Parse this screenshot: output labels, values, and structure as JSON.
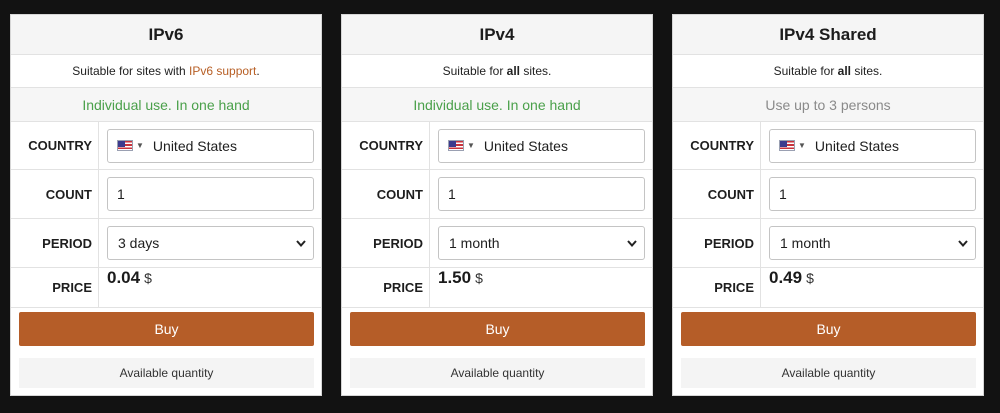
{
  "colors": {
    "background": "#121212",
    "accent": "#b55d28",
    "link": "#b75e24",
    "usage_green": "#4aa04a",
    "usage_gray": "#8a8a8a"
  },
  "labels": {
    "country": "COUNTRY",
    "count": "COUNT",
    "period": "PERIOD",
    "price": "PRICE",
    "buy": "Buy",
    "available": "Available quantity"
  },
  "cards": [
    {
      "title": "IPv6",
      "desc_pre": "Suitable for sites with ",
      "desc_link": "IPv6 support",
      "desc_post": ".",
      "usage": "Individual use. In one hand",
      "country": "United States",
      "flag_icon": "us-flag-icon",
      "count": "1",
      "period": "3 days",
      "price": "0.04",
      "currency": "$"
    },
    {
      "title": "IPv4",
      "desc_pre": "Suitable for ",
      "desc_bold": "all",
      "desc_post": " sites.",
      "usage": "Individual use. In one hand",
      "country": "United States",
      "flag_icon": "us-flag-icon",
      "count": "1",
      "period": "1 month",
      "price": "1.50",
      "currency": "$"
    },
    {
      "title": "IPv4 Shared",
      "desc_pre": "Suitable for ",
      "desc_bold": "all",
      "desc_post": " sites.",
      "usage": "Use up to 3 persons",
      "country": "United States",
      "flag_icon": "us-flag-icon",
      "count": "1",
      "period": "1 month",
      "price": "0.49",
      "currency": "$"
    }
  ]
}
